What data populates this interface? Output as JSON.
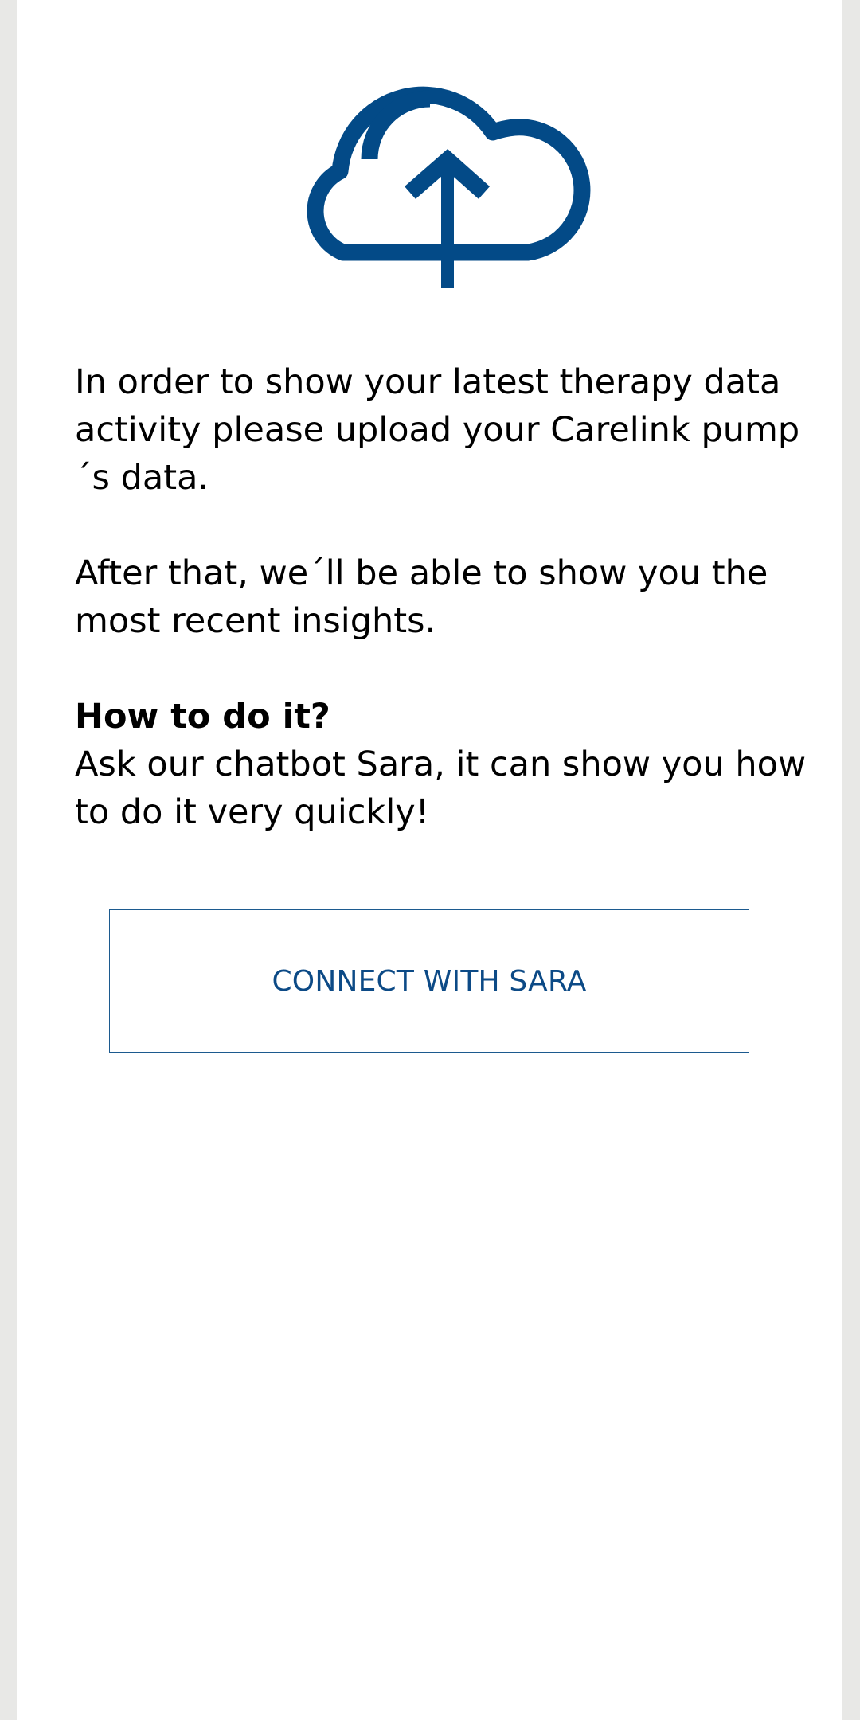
{
  "icon": {
    "name": "cloud-upload-icon",
    "color": "#034a87"
  },
  "message": {
    "paragraph1": "In order to show your latest therapy data activity please upload your Carelink pump´s data.",
    "paragraph2": "After that, we´ll be able to show you the most recent insights.",
    "howto_title": "How to do it?",
    "howto_text": "Ask our chatbot Sara, it can show you how to do it very quickly!"
  },
  "button": {
    "label": "CONNECT WITH SARA",
    "color": "#0c4a86"
  }
}
